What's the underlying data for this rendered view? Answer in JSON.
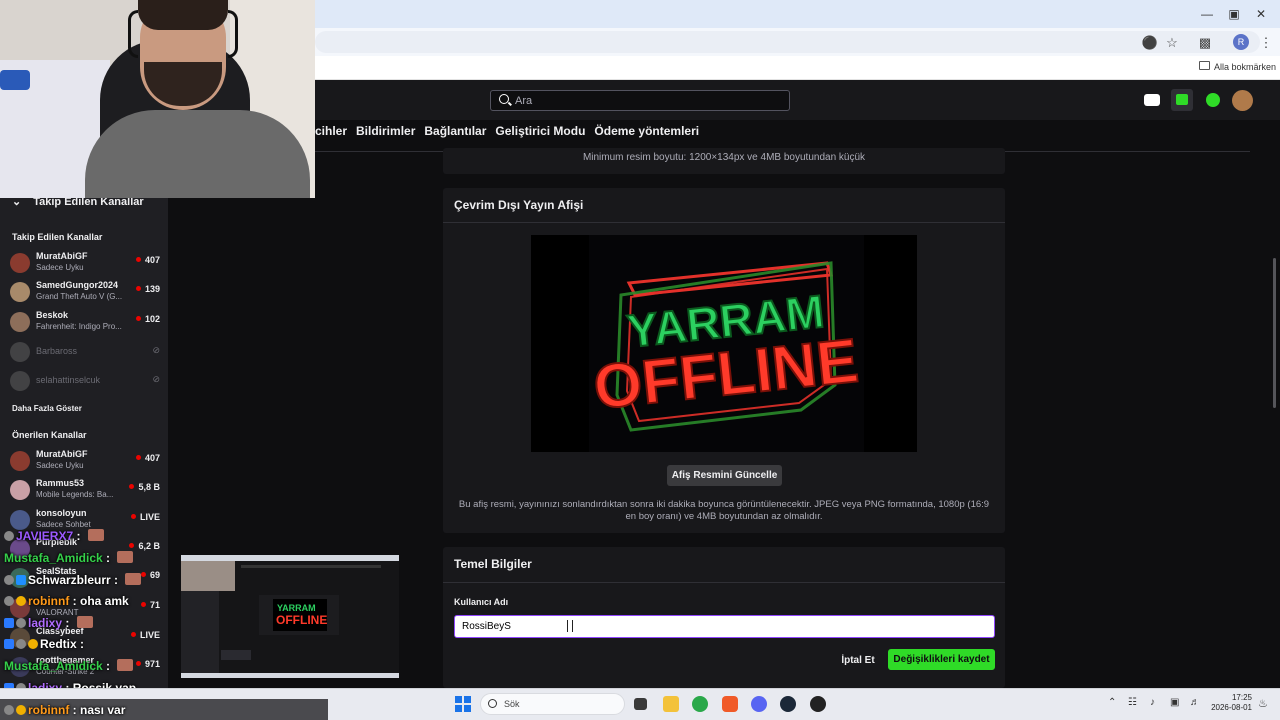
{
  "browser": {
    "bookmarks_label": "Alla bokmärken",
    "profile_initial": "R"
  },
  "topnav": {
    "search_placeholder": "Ara"
  },
  "subnav": [
    "cihler",
    "Bildirimler",
    "Bağlantılar",
    "Geliştirici Modu",
    "Ödeme yöntemleri"
  ],
  "sidebar": {
    "collapse_label": "Takip Edilen Kanallar",
    "followed_header": "Takip Edilen Kanallar",
    "followed": [
      {
        "name": "MuratAbiGF",
        "game": "Sadece Uyku",
        "viewers": "407",
        "color": "#8a3b2f"
      },
      {
        "name": "SamedGungor2024",
        "game": "Grand Theft Auto V (G...",
        "viewers": "139",
        "color": "#a88a6a"
      },
      {
        "name": "Beskok",
        "game": "Fahrenheit: Indigo Pro...",
        "viewers": "102",
        "color": "#8d6e5a"
      },
      {
        "name": "Barbaross",
        "game": "",
        "viewers": "",
        "color": "#6b6b6b"
      },
      {
        "name": "selahattinselcuk",
        "game": "",
        "viewers": "",
        "color": "#5d5d5d"
      }
    ],
    "show_more": "Daha Fazla Göster",
    "recommended_header": "Önerilen Kanallar",
    "recommended": [
      {
        "name": "MuratAbiGF",
        "game": "Sadece Uyku",
        "viewers": "407",
        "color": "#8a3b2f"
      },
      {
        "name": "Rammus53",
        "game": "Mobile Legends: Ba...",
        "viewers": "5,8 B",
        "color": "#c9a0a6"
      },
      {
        "name": "konsoloyun",
        "game": "Sadece Sohbet",
        "viewers": "LIVE",
        "color": "#4a5a8a"
      },
      {
        "name": "Purpleblk",
        "game": "",
        "viewers": "6,2 B",
        "color": "#6a4a8a"
      },
      {
        "name": "SealStats",
        "game": "",
        "viewers": "69",
        "color": "#3a6a5a"
      },
      {
        "name": "",
        "game": "VALORANT",
        "viewers": "71",
        "color": "#7a3a3a"
      },
      {
        "name": "Classybeef",
        "game": "",
        "viewers": "LIVE",
        "color": "#5a4a3a"
      },
      {
        "name": "roottbegamer",
        "game": "Counter-Strike 2",
        "viewers": "971",
        "color": "#3a3a5a"
      }
    ]
  },
  "content": {
    "min_res_note": "Minimum resim boyutu: 1200×134px ve 4MB boyutundan küçük",
    "offline_title": "Çevrim Dışı Yayın Afişi",
    "banner_line1": "YARRAM",
    "banner_line2": "OFFLINE",
    "update_button": "Afiş Resmini Güncelle",
    "banner_note": "Bu afiş resmi, yayınınızı sonlandırdıktan sonra iki dakika boyunca görüntülenecektir. JPEG veya PNG formatında, 1080p (16:9 en boy oranı) ve 4MB boyutundan az olmalıdır.",
    "basic_title": "Temel Bilgiler",
    "username_label": "Kullanıcı Adı",
    "username_value": "RossiBeyS",
    "cancel_button": "İptal Et",
    "save_button": "Değişiklikleri kaydet"
  },
  "chat": [
    {
      "user": "JAVIERX7",
      "msg": "",
      "color": "#9b59ff"
    },
    {
      "user": "Mustafa_Amidick",
      "msg": "",
      "color": "#35d04a"
    },
    {
      "user": "Schwarzbleurr",
      "msg": "",
      "color": "#ffffff"
    },
    {
      "user": "robinnf",
      "msg": "oha amk",
      "color": "#ff9a1a"
    },
    {
      "user": "ladixy",
      "msg": "",
      "color": "#b06cff"
    },
    {
      "user": "Redtix",
      "msg": "",
      "color": "#ffffff"
    },
    {
      "user": "Mustafa_Amidick",
      "msg": "",
      "color": "#35d04a"
    },
    {
      "user": "ladixy",
      "msg": "Rossik yap",
      "color": "#b06cff"
    },
    {
      "user": "robinnf",
      "msg": "nası var",
      "color": "#ff9a1a"
    }
  ],
  "mini": {
    "line1": "YARRAM",
    "line2": "OFFLINE"
  },
  "taskbar": {
    "search_placeholder": "Sök",
    "time": "17:25",
    "date": "2026-08-01"
  }
}
